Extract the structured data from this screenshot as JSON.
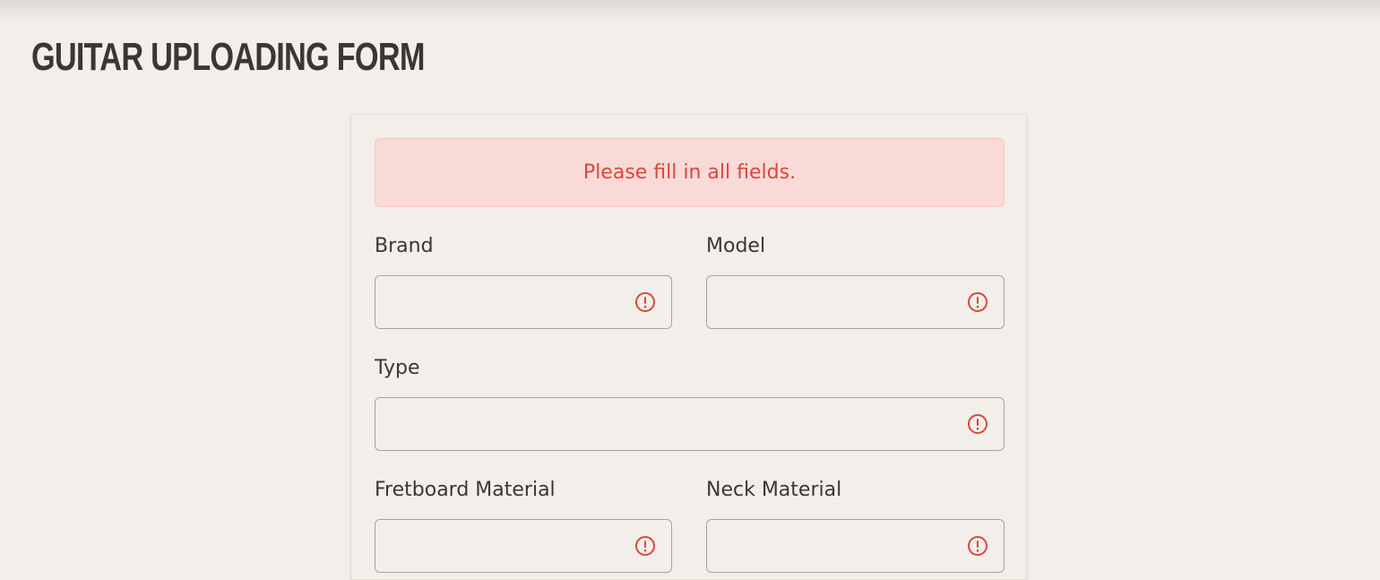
{
  "page": {
    "title": "GUITAR UPLOADING FORM"
  },
  "form": {
    "alert": "Please fill in all fields.",
    "fields": {
      "brand": {
        "label": "Brand",
        "value": "",
        "status_icon": "alert-circle-icon"
      },
      "model": {
        "label": "Model",
        "value": "",
        "status_icon": "alert-circle-icon"
      },
      "type": {
        "label": "Type",
        "value": "",
        "status_icon": "alert-circle-icon"
      },
      "fretboard_material": {
        "label": "Fretboard Material",
        "value": "",
        "status_icon": "alert-circle-icon"
      },
      "neck_material": {
        "label": "Neck Material",
        "value": "",
        "status_icon": "alert-circle-icon"
      }
    }
  },
  "colors": {
    "background": "#f2efea",
    "text": "#3b3631",
    "error": "#d9473b",
    "alert_background": "#fadad7",
    "input_border": "#a6a29d"
  }
}
